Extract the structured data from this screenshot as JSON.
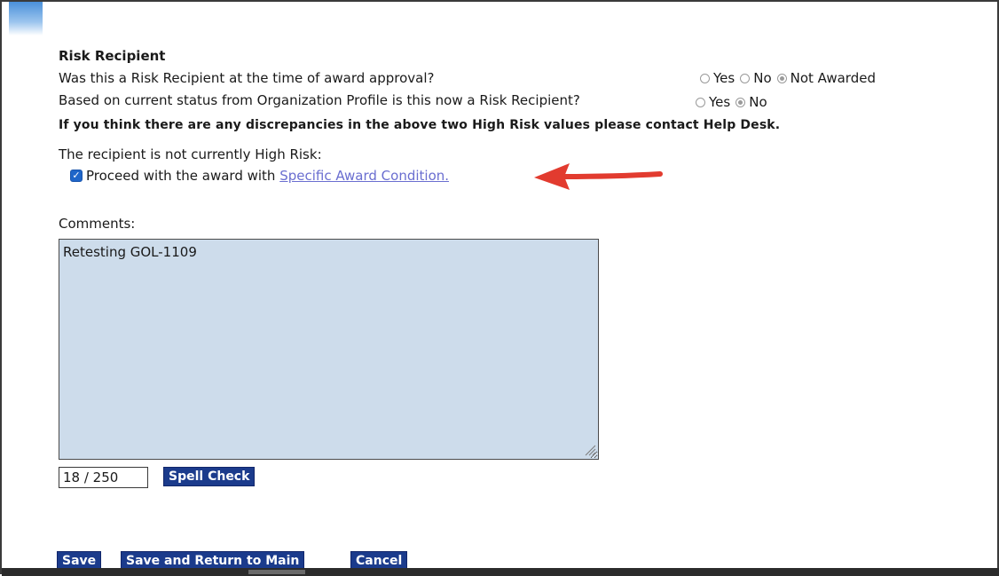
{
  "section": {
    "title": "Risk Recipient",
    "q1": {
      "label": "Was this a Risk Recipient at the time of award approval?",
      "options": [
        "Yes",
        "No",
        "Not Awarded"
      ],
      "selected": "Not Awarded"
    },
    "q2": {
      "label": "Based on current status from Organization Profile is this now a Risk Recipient?",
      "options": [
        "Yes",
        "No"
      ],
      "selected": "No"
    },
    "notice": "If you think there are any discrepancies in the above two High Risk values please contact Help Desk.",
    "status_text": "The recipient is not currently High Risk:",
    "proceed": {
      "checked": true,
      "label": "Proceed with the award with",
      "link": "Specific Award Condition."
    }
  },
  "comments": {
    "label": "Comments:",
    "value": "Retesting GOL-1109",
    "counter": "18 / 250",
    "spell_check": "Spell Check"
  },
  "footer": {
    "save": "Save",
    "save_return": "Save and Return to Main",
    "cancel": "Cancel"
  },
  "colors": {
    "button_bg": "#1b3b8c",
    "textarea_bg": "#cddceb",
    "link": "#6a6ed0",
    "annotation_arrow": "#e23b2f",
    "checkbox": "#1f66c9"
  }
}
